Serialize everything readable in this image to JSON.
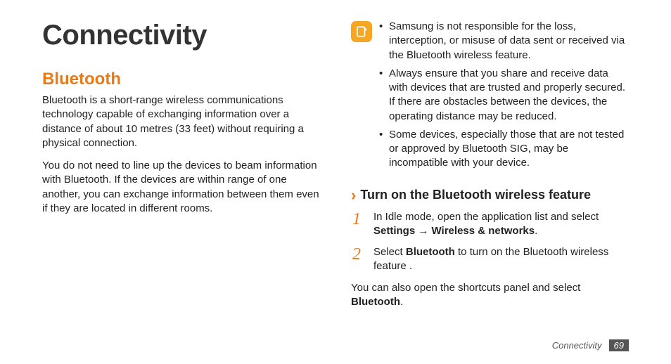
{
  "title": "Connectivity",
  "left": {
    "heading": "Bluetooth",
    "p1": "Bluetooth is a short-range wireless communications technology capable of exchanging information over a distance of about 10 metres (33 feet) without requiring a physical connection.",
    "p2": "You do not need to line up the devices to beam information with Bluetooth. If the devices are within range of one another, you can exchange information between them even if they are located in different rooms."
  },
  "right": {
    "notes": [
      "Samsung is not responsible for the loss, interception, or misuse of data sent or received via the Bluetooth wireless feature.",
      "Always ensure that you share and receive data with devices that are trusted and properly secured. If there are obstacles between the devices, the operating distance may be reduced.",
      "Some devices, especially those that are not tested or approved by Bluetooth SIG, may be incompatible with your device."
    ],
    "subheading": "Turn on the Bluetooth wireless feature",
    "step1_pre": "In Idle mode, open the application list and select ",
    "step1_b1": "Settings",
    "step1_arrow": " → ",
    "step1_b2": "Wireless & networks",
    "step1_post": ".",
    "step2_pre": "Select ",
    "step2_b": "Bluetooth",
    "step2_post": " to turn on the Bluetooth wireless feature .",
    "tail_pre": "You can also open the shortcuts panel and select ",
    "tail_b": "Bluetooth",
    "tail_post": "."
  },
  "footer": {
    "section": "Connectivity",
    "page": "69"
  }
}
